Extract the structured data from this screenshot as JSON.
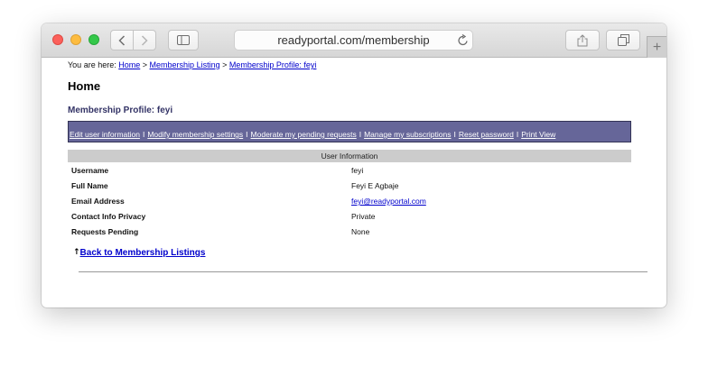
{
  "browser": {
    "address": "readyportal.com/membership",
    "icons": {
      "back": "chevron-left-icon",
      "forward": "chevron-right-icon",
      "sidebar": "sidebar-icon",
      "reload": "reload-icon",
      "share": "share-icon",
      "tabs": "tabs-icon",
      "new_tab": "plus-icon"
    }
  },
  "breadcrumb": {
    "prefix": "You are here:",
    "items": [
      "Home",
      "Membership Listing",
      "Membership Profile: feyi"
    ],
    "separator": ">"
  },
  "page": {
    "title": "Home",
    "profile_heading": "Membership Profile: feyi"
  },
  "actions": [
    "Edit user information",
    "Modify membership settings",
    "Moderate my pending requests",
    "Manage my subscriptions",
    "Reset password",
    "Print View"
  ],
  "actions_separator": "I",
  "user_info": {
    "header": "User Information",
    "rows": [
      {
        "label": "Username",
        "value": "feyi"
      },
      {
        "label": "Full Name",
        "value": "Feyi E Agbaje"
      },
      {
        "label": "Email Address",
        "value": "feyi@readyportal.com"
      },
      {
        "label": "Contact Info Privacy",
        "value": "Private"
      },
      {
        "label": "Requests Pending",
        "value": "None"
      }
    ]
  },
  "back_link": {
    "arrow": "↑",
    "label": "Back to Membership Listings"
  },
  "colors": {
    "action_bar": "#666699",
    "heading": "#333366",
    "link": "#0000cc",
    "info_header": "#cccccc"
  }
}
